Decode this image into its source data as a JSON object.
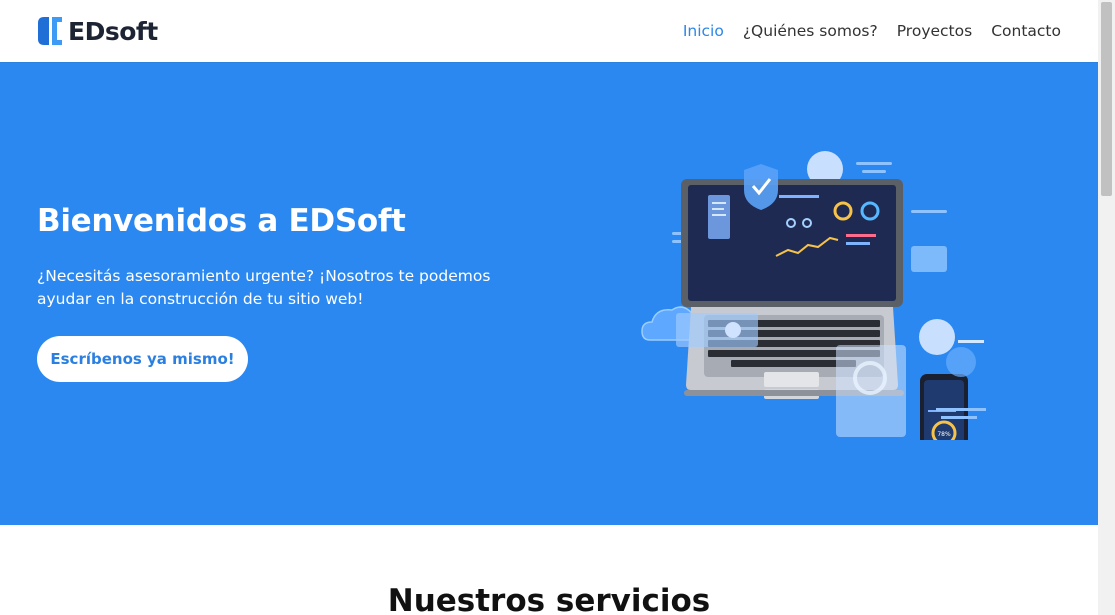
{
  "header": {
    "logo_text": "EDsoft",
    "nav": [
      {
        "label": "Inicio",
        "active": true
      },
      {
        "label": "¿Quiénes somos?",
        "active": false
      },
      {
        "label": "Proyectos",
        "active": false
      },
      {
        "label": "Contacto",
        "active": false
      }
    ]
  },
  "hero": {
    "title": "Bienvenidos a EDSoft",
    "subtitle": "¿Necesitás asesoramiento urgente? ¡Nosotros te podemos ayudar en la construcción de tu sitio web!",
    "cta_label": "Escríbenos ya mismo!",
    "illustration_icon": "laptop-phone-illustration",
    "phone_gauge_label": "78%"
  },
  "services": {
    "title": "Nuestros servicios"
  },
  "colors": {
    "brand_blue": "#2b88f0",
    "nav_active": "#2b87e8",
    "button_text": "#2b7fe0",
    "logo_dark": "#1d2433"
  }
}
